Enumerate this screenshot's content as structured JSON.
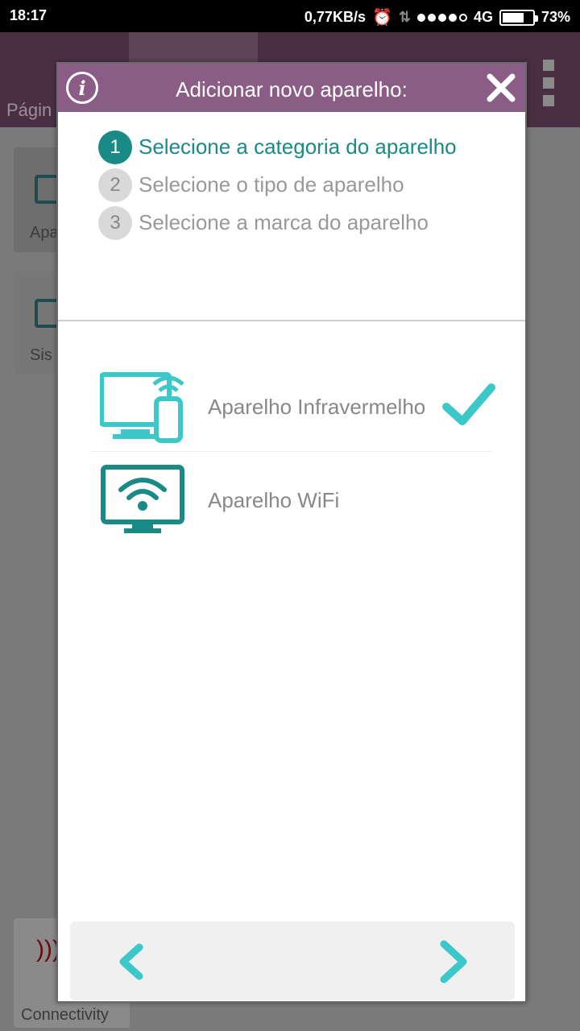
{
  "status_bar": {
    "time": "18:17",
    "speed": "0,77KB/s",
    "network": "4G",
    "battery": "73%",
    "battery_level": 0.73
  },
  "background": {
    "header_label": "Págin",
    "card1_label": "Apa",
    "card2_label": "Sis",
    "connectivity_label": "Connectivity"
  },
  "dialog": {
    "title": "Adicionar novo aparelho:",
    "steps": [
      {
        "number": "1",
        "label": "Selecione a categoria do aparelho",
        "active": true
      },
      {
        "number": "2",
        "label": "Selecione o tipo de aparelho",
        "active": false
      },
      {
        "number": "3",
        "label": "Selecione a marca do aparelho",
        "active": false
      }
    ],
    "options": [
      {
        "label": "Aparelho Infravermelho",
        "icon": "tv-remote-icon",
        "selected": true
      },
      {
        "label": "Aparelho WiFi",
        "icon": "tv-wifi-icon",
        "selected": false
      }
    ]
  },
  "colors": {
    "header": "#8a5c86",
    "active_step": "#1a8a86",
    "accent": "#3cc8c8"
  }
}
